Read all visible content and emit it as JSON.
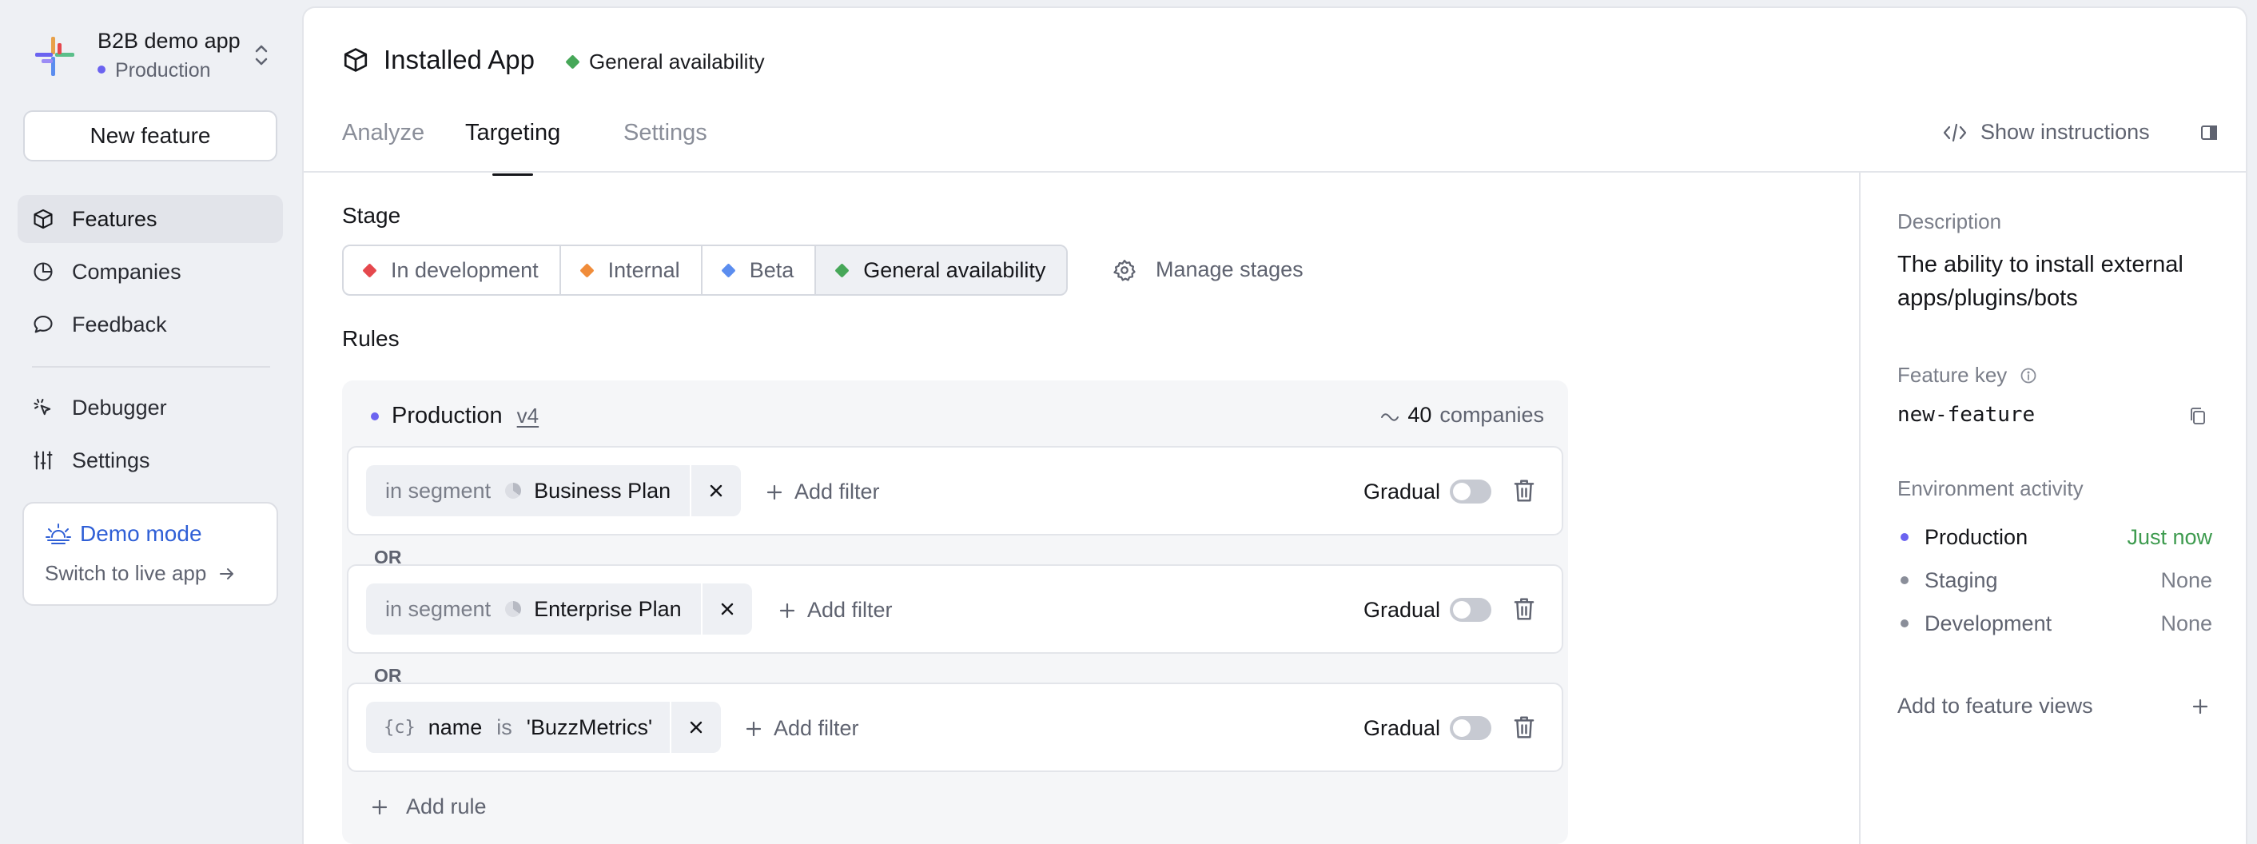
{
  "app": {
    "name": "B2B demo app",
    "environment": "Production"
  },
  "sidebar": {
    "new_feature_label": "New feature",
    "items": [
      {
        "label": "Features",
        "icon": "cube-icon",
        "active": true
      },
      {
        "label": "Companies",
        "icon": "pie-chart-icon",
        "active": false
      },
      {
        "label": "Feedback",
        "icon": "chat-bubble-icon",
        "active": false
      },
      {
        "label": "Debugger",
        "icon": "pointer-click-icon",
        "active": false
      },
      {
        "label": "Settings",
        "icon": "sliders-icon",
        "active": false
      }
    ],
    "demo": {
      "title": "Demo mode",
      "subtitle": "Switch to live app"
    }
  },
  "header": {
    "title": "Installed App",
    "stage": "General availability",
    "tabs": [
      "Analyze",
      "Targeting",
      "Settings"
    ],
    "active_tab": "Targeting",
    "show_instructions": "Show instructions"
  },
  "stage_section": {
    "label": "Stage",
    "stages": [
      {
        "label": "In development",
        "color": "#e5484d"
      },
      {
        "label": "Internal",
        "color": "#f08c3a"
      },
      {
        "label": "Beta",
        "color": "#5b8def"
      },
      {
        "label": "General availability",
        "color": "#46a758"
      }
    ],
    "active_stage": "General availability",
    "manage_label": "Manage stages"
  },
  "rules": {
    "label": "Rules",
    "environment": "Production",
    "version": "v4",
    "count": "40",
    "count_unit": "companies",
    "items": [
      {
        "filter_prefix": "in segment",
        "filter_value": "Business Plan",
        "add_filter": "Add filter",
        "gradual": "Gradual",
        "gradual_on": false
      },
      {
        "filter_prefix": "in segment",
        "filter_value": "Enterprise Plan",
        "add_filter": "Add filter",
        "gradual": "Gradual",
        "gradual_on": false
      },
      {
        "attr_icon": "{c}",
        "attr_name": "name",
        "operator": "is",
        "attr_value": "'BuzzMetrics'",
        "add_filter": "Add filter",
        "gradual": "Gradual",
        "gradual_on": false
      }
    ],
    "or_label": "OR",
    "add_rule": "Add rule"
  },
  "details": {
    "description_label": "Description",
    "description": "The ability to install external apps/plugins/bots",
    "feature_key_label": "Feature key",
    "feature_key": "new-feature",
    "env_activity_label": "Environment activity",
    "environments": [
      {
        "name": "Production",
        "value": "Just now",
        "dot_color": "#6b63f0",
        "value_color": "#3e9b4f"
      },
      {
        "name": "Staging",
        "value": "None",
        "dot_color": "#8a8e99",
        "value_color": "#7a7e89"
      },
      {
        "name": "Development",
        "value": "None",
        "dot_color": "#8a8e99",
        "value_color": "#7a7e89"
      }
    ],
    "add_views": "Add to feature views"
  },
  "colors": {
    "accent": "#6b63f0",
    "demo_blue": "#2f5fd6",
    "success": "#3e9b4f"
  }
}
